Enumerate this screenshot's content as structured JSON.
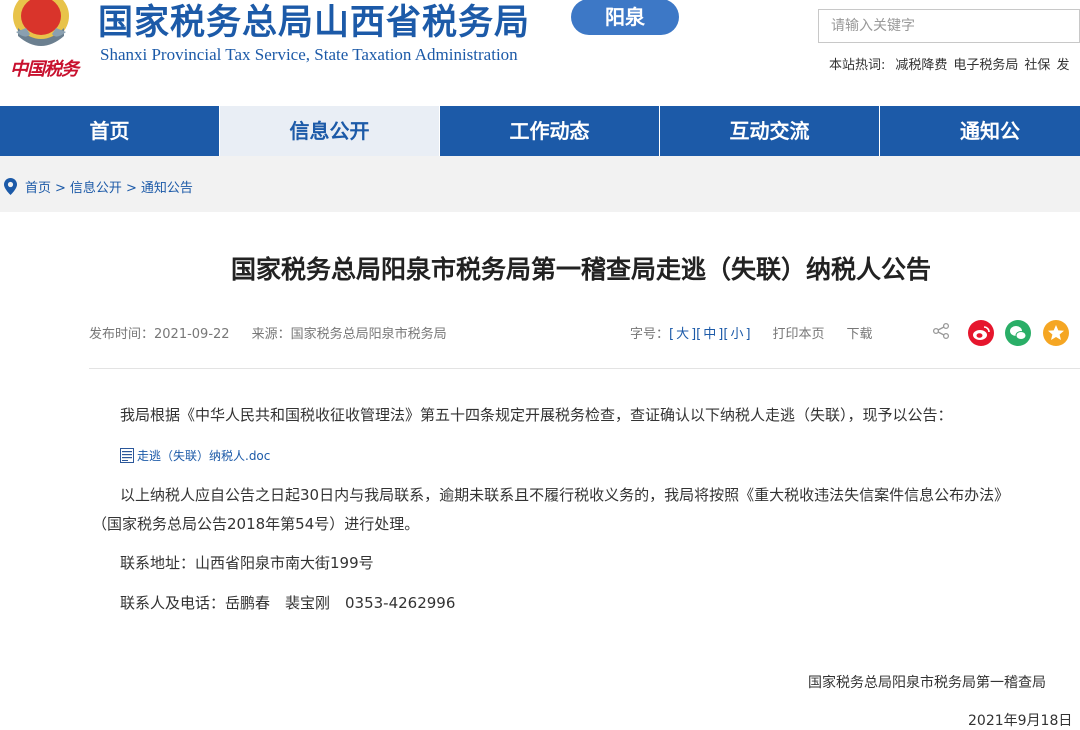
{
  "header": {
    "logo_text": "中国税务",
    "title": "国家税务总局山西省税务局",
    "subtitle": "Shanxi Provincial Tax Service, State Taxation Administration",
    "city_badge": "阳泉",
    "search": {
      "placeholder": "请输入关键字"
    },
    "hot_words": {
      "label": "本站热词:",
      "items": [
        "减税降费",
        "电子税务局",
        "社保",
        "发"
      ]
    }
  },
  "nav": {
    "items": [
      "首页",
      "信息公开",
      "工作动态",
      "互动交流",
      "通知公"
    ],
    "active": "信息公开"
  },
  "breadcrumb": {
    "items": [
      "首页",
      "信息公开",
      "通知公告"
    ],
    "separator": ">"
  },
  "article": {
    "title": "国家税务总局阳泉市税务局第一稽查局走逃（失联）纳税人公告",
    "meta": {
      "publish_time": "发布时间：2021-09-22",
      "source": "来源：国家税务总局阳泉市税务局",
      "font_size_label": "字号：",
      "font_sizes": [
        "大",
        "中",
        "小"
      ],
      "print": "打印本页",
      "download": "下载"
    },
    "para1": "我局根据《中华人民共和国税收征收管理法》第五十四条规定开展税务检查，查证确认以下纳税人走逃（失联），现予以公告：",
    "attachment": "走逃（失联）纳税人.doc",
    "para2_line1": "以上纳税人应自公告之日起30日内与我局联系，逾期未联系且不履行税收义务的，我局将按照《重大税收违法失信案件信息公布办法》",
    "para2_line2": "（国家税务总局公告2018年第54号）进行处理。",
    "address": "联系地址：山西省阳泉市南大街199号",
    "contact": "联系人及电话：岳鹏春　裴宝刚　0353-4262996",
    "signature_org": "国家税务总局阳泉市税务局第一稽查局",
    "signature_date": "2021年9月18日"
  }
}
